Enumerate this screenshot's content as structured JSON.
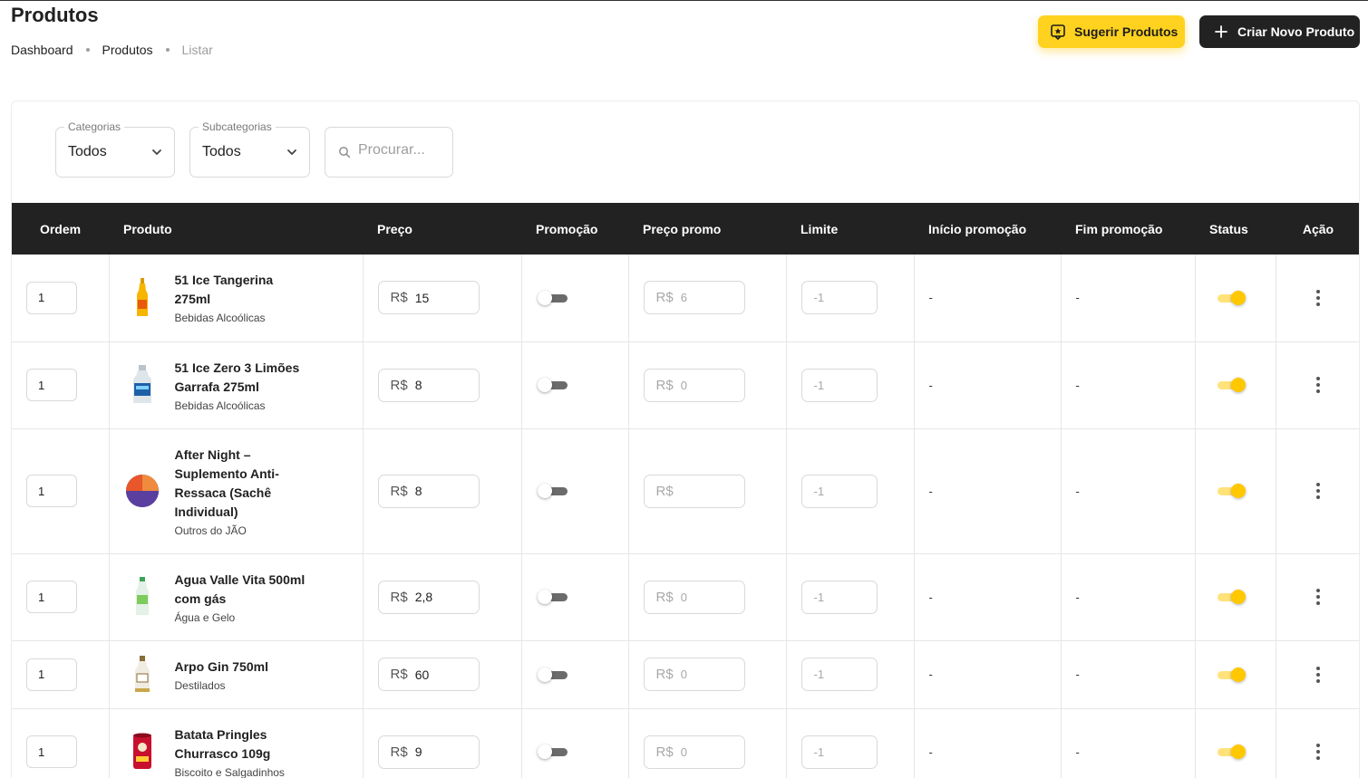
{
  "header": {
    "title": "Produtos",
    "breadcrumb": [
      "Dashboard",
      "Produtos",
      "Listar"
    ],
    "suggest_label": "Sugerir Produtos",
    "create_label": "Criar Novo Produto"
  },
  "filters": {
    "categories_label": "Categorias",
    "categories_value": "Todos",
    "subcategories_label": "Subcategorias",
    "subcategories_value": "Todos",
    "search_placeholder": "Procurar..."
  },
  "table": {
    "columns": [
      "Ordem",
      "Produto",
      "Preço",
      "Promoção",
      "Preço promo",
      "Limite",
      "Início promoção",
      "Fim promoção",
      "Status",
      "Ação"
    ],
    "currency": "R$",
    "rows": [
      {
        "ordem": "1",
        "name": "51 Ice Tangerina 275ml",
        "category": "Bebidas Alcoólicas",
        "price": "15",
        "promo_price": "6",
        "limit": "-1",
        "start": "-",
        "end": "-",
        "promo_on": false,
        "status_on": true
      },
      {
        "ordem": "1",
        "name": "51 Ice Zero 3 Limões Garrafa 275ml",
        "category": "Bebidas Alcoólicas",
        "price": "8",
        "promo_price": "0",
        "limit": "-1",
        "start": "-",
        "end": "-",
        "promo_on": false,
        "status_on": true
      },
      {
        "ordem": "1",
        "name": "After Night – Suplemento Anti-Ressaca (Sachê Individual)",
        "category": "Outros do JÃO",
        "price": "8",
        "promo_price": "",
        "limit": "-1",
        "start": "-",
        "end": "-",
        "promo_on": false,
        "status_on": true
      },
      {
        "ordem": "1",
        "name": "Agua Valle Vita 500ml com gás",
        "category": "Água e Gelo",
        "price": "2,8",
        "promo_price": "0",
        "limit": "-1",
        "start": "-",
        "end": "-",
        "promo_on": false,
        "status_on": true
      },
      {
        "ordem": "1",
        "name": "Arpo Gin 750ml",
        "category": "Destilados",
        "price": "60",
        "promo_price": "0",
        "limit": "-1",
        "start": "-",
        "end": "-",
        "promo_on": false,
        "status_on": true
      },
      {
        "ordem": "1",
        "name": "Batata Pringles Churrasco 109g",
        "category": "Biscoito e Salgadinhos",
        "price": "9",
        "promo_price": "0",
        "limit": "-1",
        "start": "-",
        "end": "-",
        "promo_on": false,
        "status_on": true
      }
    ]
  },
  "colors": {
    "accent_yellow": "#ffd21f",
    "dark": "#222222",
    "toggle_on": "#ffc800"
  },
  "icons": {
    "suggest": "tag-star-icon",
    "create": "plus-icon",
    "search": "search-icon",
    "dropdown": "chevron-down-icon",
    "row_action": "more-vertical-icon"
  }
}
